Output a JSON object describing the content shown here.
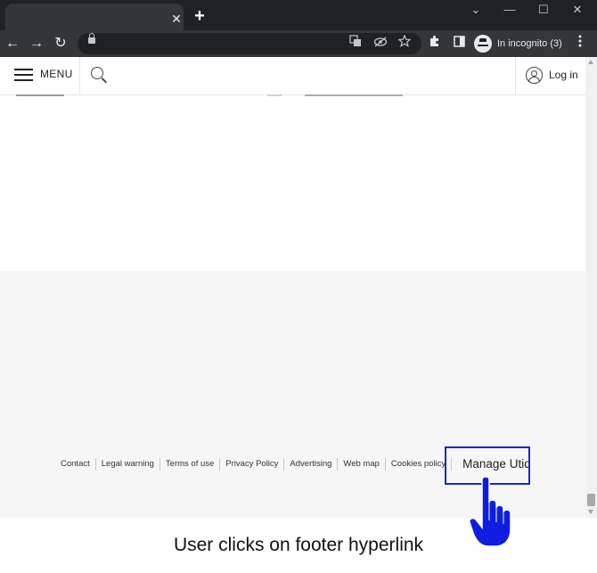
{
  "browser": {
    "incognito_label": "In incognito (3)",
    "tab_close_glyph": "✕",
    "new_tab_glyph": "+",
    "window_controls": [
      "⌄",
      "—",
      "☐",
      "✕"
    ],
    "nav_glyphs": {
      "back": "←",
      "forward": "→",
      "reload": "↻"
    },
    "icons": [
      "translate-icon",
      "eye-off-icon",
      "star-icon",
      "puzzle-icon",
      "side-panel-icon",
      "kebab-menu-icon"
    ]
  },
  "site_header": {
    "menu_label": "MENU",
    "login_label": "Log in"
  },
  "footer": {
    "links": [
      "Contact",
      "Legal warning",
      "Terms of use",
      "Privacy Policy",
      "Advertising",
      "Web map",
      "Cookies policy",
      "Manage Utiq"
    ]
  },
  "annotation": {
    "caption": "User clicks on footer hyperlink",
    "highlight_color": "#1a24d6",
    "hand_color": "#0f1de0"
  }
}
